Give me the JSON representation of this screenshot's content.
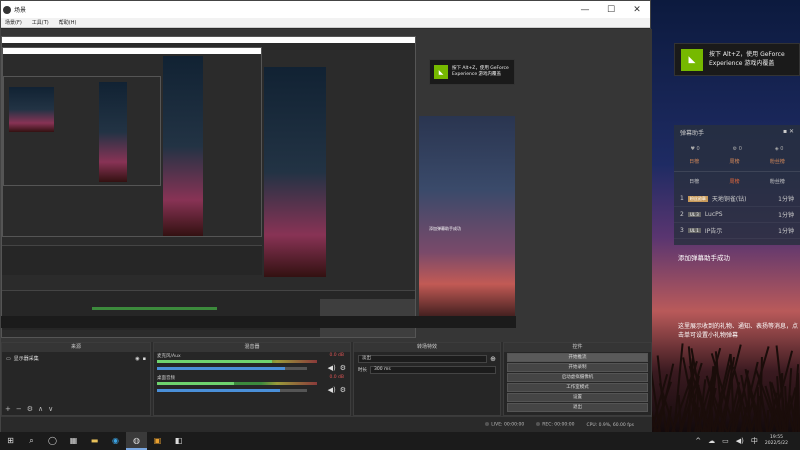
{
  "window": {
    "title": "场景",
    "minimize": "—",
    "maximize": "☐",
    "close": "✕"
  },
  "menu": [
    "场景(F)",
    "工具(T)",
    "帮助(H)"
  ],
  "toast": {
    "line1": "按下 Alt+Z，使用 GeForce",
    "line2": "Experience 游戏内覆盖"
  },
  "chat": {
    "title": "弹幕助手",
    "tabs": [
      "日榜",
      "周榜",
      "粉丝榜"
    ],
    "sub": [
      "日榜",
      "周榜",
      "粉丝榜"
    ],
    "rows": [
      {
        "rank": "1",
        "tag": "粉丝勋章",
        "name": "天地铜雀(钻)",
        "val": "1分钟"
      },
      {
        "rank": "2",
        "tag": "UL 3",
        "name": "LucPS",
        "val": "1分钟"
      },
      {
        "rank": "3",
        "tag": "UL 1",
        "name": "IP告示",
        "val": "1分钟"
      }
    ],
    "msg1": "添加弹幕助手成功",
    "msg2": "这里展示收到的礼物、通知、表扬等消息，点击单可设置小礼物弹幕"
  },
  "docks": {
    "sources": {
      "title": "来源",
      "items": [
        "显示器采集"
      ]
    },
    "mixer": {
      "title": "混音器",
      "channels": [
        {
          "name": "麦克风/Aux",
          "db": "0.0 dB",
          "level": 0.72,
          "volume": 0.85
        },
        {
          "name": "桌面音频",
          "db": "0.0 dB",
          "level": 0.48,
          "volume": 0.82
        }
      ]
    },
    "transitions": {
      "title": "转场特效",
      "type": "淡出",
      "duration_label": "时长",
      "duration": "300 ms"
    },
    "controls": {
      "title": "控件",
      "buttons": [
        "开始推流",
        "开始录制",
        "启动虚拟摄像机",
        "工作室模式",
        "设置",
        "退出"
      ]
    }
  },
  "status": {
    "live": "LIVE: 00:00:00",
    "rec": "REC: 00:00:00",
    "cpu": "CPU: 0.9%, 60.00 fps"
  },
  "taskbar": {
    "items": [
      "⊞",
      "⌕",
      "◯",
      "▦",
      "▬",
      "◉",
      "◍",
      "▣",
      "◧"
    ],
    "tray": [
      "^",
      "☁",
      "▭",
      "◀)",
      "中"
    ],
    "time": "19:55",
    "date": "2022/5/22"
  }
}
